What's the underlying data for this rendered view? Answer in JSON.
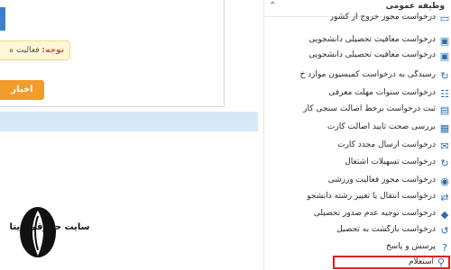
{
  "notice": {
    "label": "توجه:",
    "text": "فعالیت ه"
  },
  "news_button": {
    "label": "اخبار"
  },
  "logo": {
    "caption": "سایت حقوقی دیتا"
  },
  "sidebar": {
    "section_title": "وظیفه عمومی",
    "items": [
      {
        "label": "درخواست مجوز خروج از کشور",
        "icon": "passport-icon"
      },
      {
        "label": "درخواست معافیت تحصیلی دانشجویی",
        "icon": "id-card-icon"
      },
      {
        "label": "درخواست معافیت تحصیلی دانشجویی",
        "icon": "id-card-icon"
      },
      {
        "label": "رسیدگی به درخواست کمیسیون موارد خ",
        "icon": "refresh-icon"
      },
      {
        "label": "درخواست سنوات مهلت معرفی",
        "icon": "gear-list-icon"
      },
      {
        "label": "ثبت درخواست برخط اصالت سنجی کار",
        "icon": "certificate-icon"
      },
      {
        "label": "بررسی صحت تایید اصالت کارت",
        "icon": "card-check-icon"
      },
      {
        "label": "درخواست ارسال مجدد کارت",
        "icon": "mail-icon"
      },
      {
        "label": "درخواست تسهیلات اشتغال",
        "icon": "refresh-icon"
      },
      {
        "label": "درخواست مجوز فعالیت ورزشی",
        "icon": "ball-icon"
      },
      {
        "label": "درخواست انتقال یا تغییر رشته دانشجو",
        "icon": "transfer-icon"
      },
      {
        "label": "درخواست توجیه عدم صدور تحصیلی",
        "icon": "diamond-icon"
      },
      {
        "label": "درخواست بازگشت به تحصیل",
        "icon": "return-icon"
      },
      {
        "label": "پرسش و پاسخ",
        "icon": "help-icon"
      },
      {
        "label": "استعلام",
        "icon": "search-icon"
      }
    ]
  }
}
